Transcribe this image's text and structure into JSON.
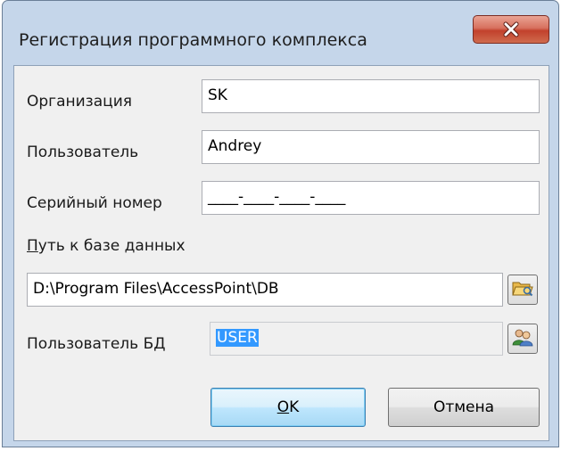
{
  "window": {
    "title": "Регистрация программного комплекса"
  },
  "form": {
    "organization": {
      "label": "Организация",
      "value": "SK"
    },
    "user": {
      "label": "Пользователь",
      "value": "Andrey"
    },
    "serial": {
      "label": "Серийный номер",
      "value": "____-____-____-____"
    },
    "db_path": {
      "label_underlined": "П",
      "label_rest": "уть к базе данных",
      "value": "D:\\Program Files\\AccessPoint\\DB"
    },
    "db_user": {
      "label": "Пользователь БД",
      "value": "USER"
    }
  },
  "buttons": {
    "ok_underlined": "O",
    "ok_rest": "K",
    "cancel": "Отмена"
  },
  "icons": {
    "close": "close-icon",
    "browse": "folder-open-icon",
    "db_users": "users-icon"
  }
}
